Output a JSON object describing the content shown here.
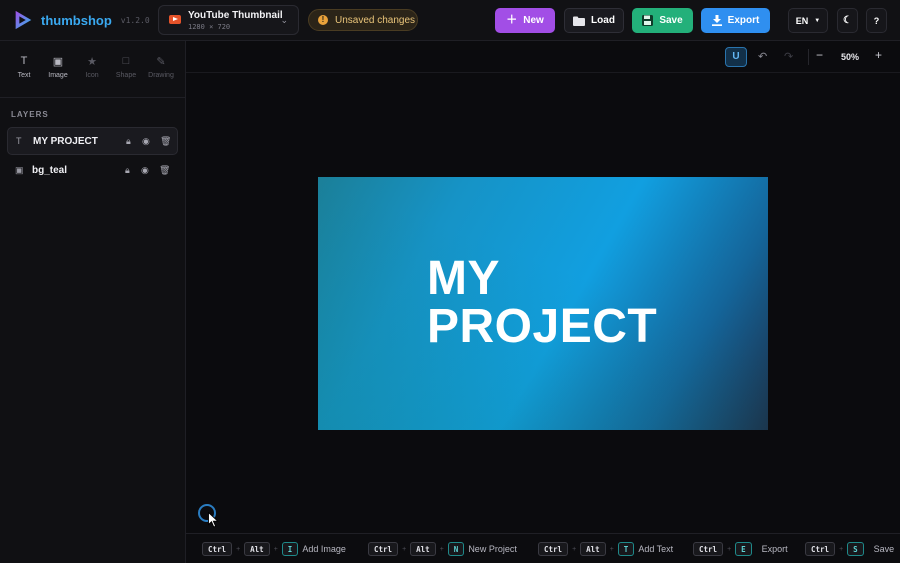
{
  "header": {
    "brand": "thumbshop",
    "version": "v1.2.0",
    "template_title": "YouTube Thumbnail",
    "template_size": "1280 × 720",
    "unsaved_label": "Unsaved changes",
    "new_label": "New",
    "load_label": "Load",
    "save_label": "Save",
    "export_label": "Export",
    "lang_label": "EN",
    "help_label": "?"
  },
  "tools": [
    {
      "label": "Text",
      "icon": "text-icon"
    },
    {
      "label": "Image",
      "icon": "image-icon"
    },
    {
      "label": "Icon",
      "icon": "star-icon"
    },
    {
      "label": "Shape",
      "icon": "square-icon"
    },
    {
      "label": "Drawing",
      "icon": "brush-icon"
    }
  ],
  "layers": {
    "title": "LAYERS",
    "items": [
      {
        "name": "MY PROJECT",
        "type": "text",
        "selected": true
      },
      {
        "name": "bg_teal",
        "type": "image",
        "selected": false
      }
    ]
  },
  "canvas": {
    "zoom": "50%",
    "headline_line1": "MY",
    "headline_line2": "PROJECT"
  },
  "shortcuts": [
    {
      "keys": [
        "Ctrl",
        "Alt",
        "I"
      ],
      "label": "Add Image"
    },
    {
      "keys": [
        "Ctrl",
        "Alt",
        "N"
      ],
      "label": "New Project"
    },
    {
      "keys": [
        "Ctrl",
        "Alt",
        "T"
      ],
      "label": "Add Text"
    },
    {
      "keys": [
        "Ctrl",
        "E"
      ],
      "label": "Export"
    },
    {
      "keys": [
        "Ctrl",
        "S"
      ],
      "label": "Save"
    }
  ],
  "colors": {
    "accent_purple": "#a24ee6",
    "accent_green": "#23b07a",
    "accent_blue": "#2f8ff0",
    "warning": "#e9a23b"
  }
}
